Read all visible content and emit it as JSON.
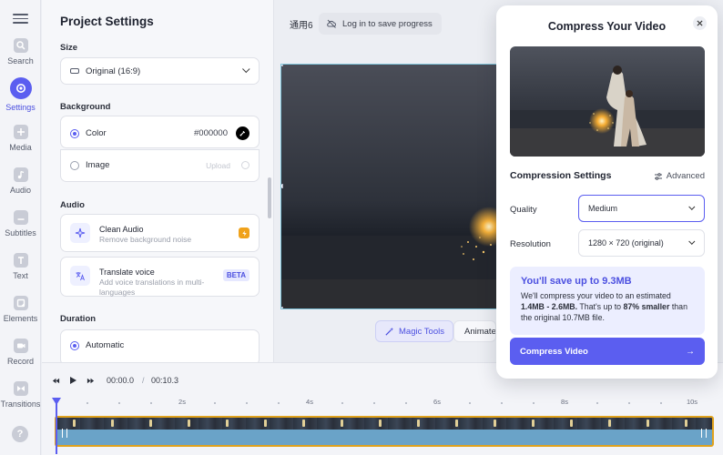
{
  "rail": {
    "items": [
      {
        "label": "Search",
        "icon": "search-icon"
      },
      {
        "label": "Settings",
        "icon": "settings-icon",
        "active": true
      },
      {
        "label": "Media",
        "icon": "media-icon"
      },
      {
        "label": "Audio",
        "icon": "audio-icon"
      },
      {
        "label": "Subtitles",
        "icon": "subtitles-icon"
      },
      {
        "label": "Text",
        "icon": "text-icon"
      },
      {
        "label": "Elements",
        "icon": "elements-icon"
      },
      {
        "label": "Record",
        "icon": "record-icon"
      },
      {
        "label": "Transitions",
        "icon": "transitions-icon"
      }
    ],
    "help": "?"
  },
  "panel": {
    "title": "Project Settings",
    "size_label": "Size",
    "size_value": "Original (16:9)",
    "background_label": "Background",
    "color_option": "Color",
    "color_value": "#000000",
    "image_option": "Image",
    "upload_label": "Upload",
    "audio_label": "Audio",
    "clean_audio_title": "Clean Audio",
    "clean_audio_sub": "Remove background noise",
    "translate_title": "Translate voice",
    "translate_sub": "Add voice translations in multi-languages",
    "beta": "BETA",
    "duration_label": "Duration",
    "automatic": "Automatic"
  },
  "topbar": {
    "workspace": "通用6",
    "login": "Log in to save progress"
  },
  "canvas": {
    "magic_tools": "Magic Tools",
    "animate": "Animate"
  },
  "timeline": {
    "current_time": "00:00.0",
    "separator": "/",
    "total_time": "00:10.3",
    "ticks": [
      "2s",
      "4s",
      "6s",
      "8s",
      "10s"
    ]
  },
  "modal": {
    "title": "Compress Your Video",
    "compression_settings": "Compression Settings",
    "advanced": "Advanced",
    "quality_label": "Quality",
    "quality_value": "Medium",
    "resolution_label": "Resolution",
    "resolution_value": "1280 × 720 (original)",
    "savings_title": "You'll save up to 9.3MB",
    "savings_pre": "We'll compress your video to an estimated ",
    "savings_range": "1.4MB - 2.6MB.",
    "savings_mid": " That's up to ",
    "savings_pct": "87% smaller",
    "savings_post": " than the original 10.7MB file.",
    "cta": "Compress Video",
    "cta_arrow": "→"
  },
  "colors": {
    "accent": "#5b5ef0",
    "track_border": "#e0a21d",
    "track_fill": "#6aa3c8",
    "bolt": "#f0a21b"
  }
}
